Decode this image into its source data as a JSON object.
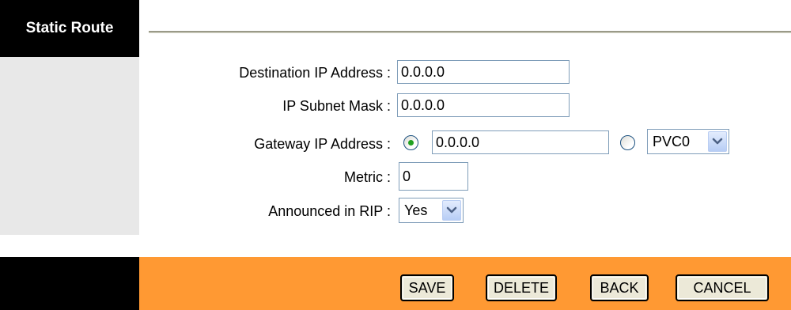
{
  "sidebar": {
    "title": "Static Route"
  },
  "form": {
    "destination_ip": {
      "label": "Destination IP Address :",
      "value": "0.0.0.0"
    },
    "subnet_mask": {
      "label": "IP Subnet Mask :",
      "value": "0.0.0.0"
    },
    "gateway": {
      "label": "Gateway IP Address :",
      "ip_value": "0.0.0.0",
      "ip_selected": true,
      "interface_selected": false,
      "interface_value": "PVC0"
    },
    "metric": {
      "label": "Metric :",
      "value": "0"
    },
    "announced_rip": {
      "label": "Announced in RIP :",
      "value": "Yes"
    }
  },
  "footer": {
    "save_label": "SAVE",
    "delete_label": "DELETE",
    "back_label": "BACK",
    "cancel_label": "CANCEL"
  },
  "colors": {
    "header_black": "#000000",
    "sidebar_gray": "#e8e8e8",
    "footer_orange": "#ff9933",
    "radio_dot": "#21a121"
  },
  "icons": {
    "dropdown": "chevron-down-icon"
  }
}
